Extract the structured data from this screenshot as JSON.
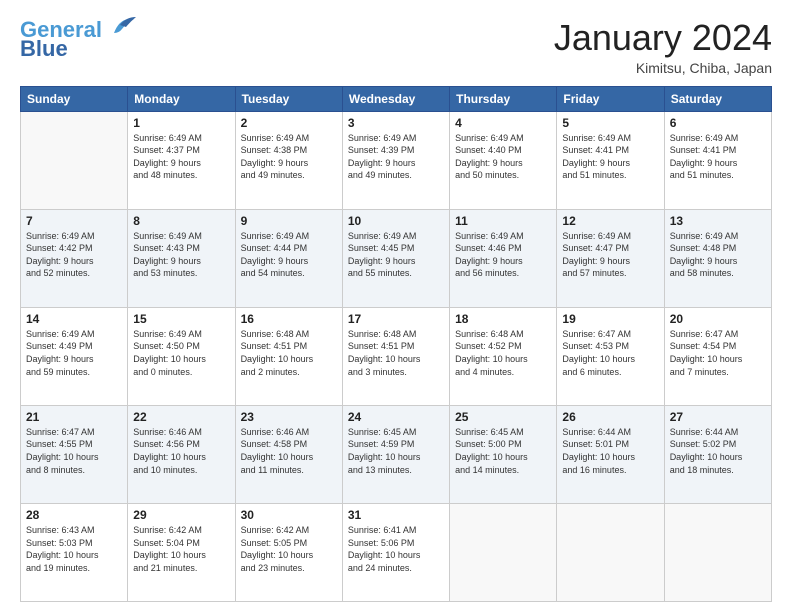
{
  "header": {
    "logo_line1": "General",
    "logo_line2": "Blue",
    "month": "January 2024",
    "location": "Kimitsu, Chiba, Japan"
  },
  "columns": [
    "Sunday",
    "Monday",
    "Tuesday",
    "Wednesday",
    "Thursday",
    "Friday",
    "Saturday"
  ],
  "weeks": [
    [
      {
        "day": "",
        "empty": true
      },
      {
        "day": "1",
        "sunrise": "Sunrise: 6:49 AM",
        "sunset": "Sunset: 4:37 PM",
        "daylight": "Daylight: 9 hours and 48 minutes."
      },
      {
        "day": "2",
        "sunrise": "Sunrise: 6:49 AM",
        "sunset": "Sunset: 4:38 PM",
        "daylight": "Daylight: 9 hours and 49 minutes."
      },
      {
        "day": "3",
        "sunrise": "Sunrise: 6:49 AM",
        "sunset": "Sunset: 4:39 PM",
        "daylight": "Daylight: 9 hours and 49 minutes."
      },
      {
        "day": "4",
        "sunrise": "Sunrise: 6:49 AM",
        "sunset": "Sunset: 4:40 PM",
        "daylight": "Daylight: 9 hours and 50 minutes."
      },
      {
        "day": "5",
        "sunrise": "Sunrise: 6:49 AM",
        "sunset": "Sunset: 4:41 PM",
        "daylight": "Daylight: 9 hours and 51 minutes."
      },
      {
        "day": "6",
        "sunrise": "Sunrise: 6:49 AM",
        "sunset": "Sunset: 4:41 PM",
        "daylight": "Daylight: 9 hours and 51 minutes."
      }
    ],
    [
      {
        "day": "7",
        "sunrise": "Sunrise: 6:49 AM",
        "sunset": "Sunset: 4:42 PM",
        "daylight": "Daylight: 9 hours and 52 minutes."
      },
      {
        "day": "8",
        "sunrise": "Sunrise: 6:49 AM",
        "sunset": "Sunset: 4:43 PM",
        "daylight": "Daylight: 9 hours and 53 minutes."
      },
      {
        "day": "9",
        "sunrise": "Sunrise: 6:49 AM",
        "sunset": "Sunset: 4:44 PM",
        "daylight": "Daylight: 9 hours and 54 minutes."
      },
      {
        "day": "10",
        "sunrise": "Sunrise: 6:49 AM",
        "sunset": "Sunset: 4:45 PM",
        "daylight": "Daylight: 9 hours and 55 minutes."
      },
      {
        "day": "11",
        "sunrise": "Sunrise: 6:49 AM",
        "sunset": "Sunset: 4:46 PM",
        "daylight": "Daylight: 9 hours and 56 minutes."
      },
      {
        "day": "12",
        "sunrise": "Sunrise: 6:49 AM",
        "sunset": "Sunset: 4:47 PM",
        "daylight": "Daylight: 9 hours and 57 minutes."
      },
      {
        "day": "13",
        "sunrise": "Sunrise: 6:49 AM",
        "sunset": "Sunset: 4:48 PM",
        "daylight": "Daylight: 9 hours and 58 minutes."
      }
    ],
    [
      {
        "day": "14",
        "sunrise": "Sunrise: 6:49 AM",
        "sunset": "Sunset: 4:49 PM",
        "daylight": "Daylight: 9 hours and 59 minutes."
      },
      {
        "day": "15",
        "sunrise": "Sunrise: 6:49 AM",
        "sunset": "Sunset: 4:50 PM",
        "daylight": "Daylight: 10 hours and 0 minutes."
      },
      {
        "day": "16",
        "sunrise": "Sunrise: 6:48 AM",
        "sunset": "Sunset: 4:51 PM",
        "daylight": "Daylight: 10 hours and 2 minutes."
      },
      {
        "day": "17",
        "sunrise": "Sunrise: 6:48 AM",
        "sunset": "Sunset: 4:51 PM",
        "daylight": "Daylight: 10 hours and 3 minutes."
      },
      {
        "day": "18",
        "sunrise": "Sunrise: 6:48 AM",
        "sunset": "Sunset: 4:52 PM",
        "daylight": "Daylight: 10 hours and 4 minutes."
      },
      {
        "day": "19",
        "sunrise": "Sunrise: 6:47 AM",
        "sunset": "Sunset: 4:53 PM",
        "daylight": "Daylight: 10 hours and 6 minutes."
      },
      {
        "day": "20",
        "sunrise": "Sunrise: 6:47 AM",
        "sunset": "Sunset: 4:54 PM",
        "daylight": "Daylight: 10 hours and 7 minutes."
      }
    ],
    [
      {
        "day": "21",
        "sunrise": "Sunrise: 6:47 AM",
        "sunset": "Sunset: 4:55 PM",
        "daylight": "Daylight: 10 hours and 8 minutes."
      },
      {
        "day": "22",
        "sunrise": "Sunrise: 6:46 AM",
        "sunset": "Sunset: 4:56 PM",
        "daylight": "Daylight: 10 hours and 10 minutes."
      },
      {
        "day": "23",
        "sunrise": "Sunrise: 6:46 AM",
        "sunset": "Sunset: 4:58 PM",
        "daylight": "Daylight: 10 hours and 11 minutes."
      },
      {
        "day": "24",
        "sunrise": "Sunrise: 6:45 AM",
        "sunset": "Sunset: 4:59 PM",
        "daylight": "Daylight: 10 hours and 13 minutes."
      },
      {
        "day": "25",
        "sunrise": "Sunrise: 6:45 AM",
        "sunset": "Sunset: 5:00 PM",
        "daylight": "Daylight: 10 hours and 14 minutes."
      },
      {
        "day": "26",
        "sunrise": "Sunrise: 6:44 AM",
        "sunset": "Sunset: 5:01 PM",
        "daylight": "Daylight: 10 hours and 16 minutes."
      },
      {
        "day": "27",
        "sunrise": "Sunrise: 6:44 AM",
        "sunset": "Sunset: 5:02 PM",
        "daylight": "Daylight: 10 hours and 18 minutes."
      }
    ],
    [
      {
        "day": "28",
        "sunrise": "Sunrise: 6:43 AM",
        "sunset": "Sunset: 5:03 PM",
        "daylight": "Daylight: 10 hours and 19 minutes."
      },
      {
        "day": "29",
        "sunrise": "Sunrise: 6:42 AM",
        "sunset": "Sunset: 5:04 PM",
        "daylight": "Daylight: 10 hours and 21 minutes."
      },
      {
        "day": "30",
        "sunrise": "Sunrise: 6:42 AM",
        "sunset": "Sunset: 5:05 PM",
        "daylight": "Daylight: 10 hours and 23 minutes."
      },
      {
        "day": "31",
        "sunrise": "Sunrise: 6:41 AM",
        "sunset": "Sunset: 5:06 PM",
        "daylight": "Daylight: 10 hours and 24 minutes."
      },
      {
        "day": "",
        "empty": true
      },
      {
        "day": "",
        "empty": true
      },
      {
        "day": "",
        "empty": true
      }
    ]
  ]
}
